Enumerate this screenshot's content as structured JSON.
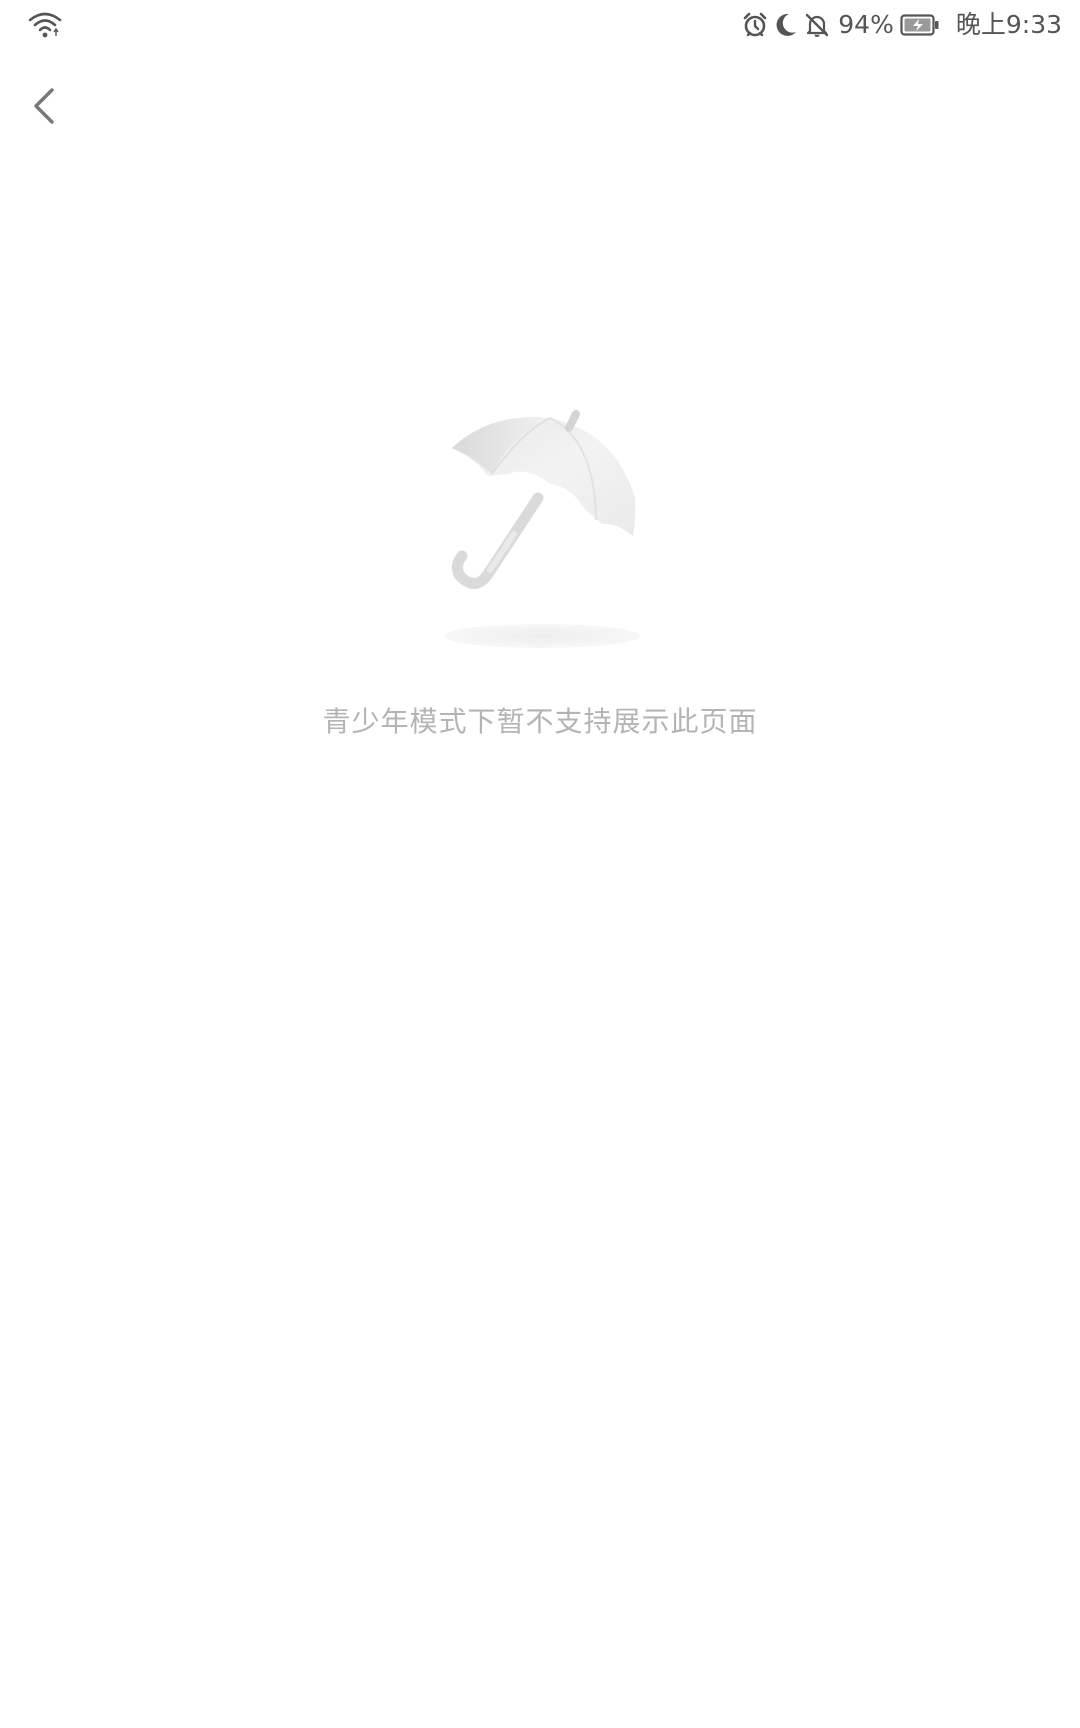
{
  "status_bar": {
    "battery_percent": "94%",
    "time": "晚上9:33",
    "icons": [
      "wifi-icon",
      "alarm-icon",
      "moon-icon",
      "bell-off-icon",
      "battery-charging-icon"
    ]
  },
  "nav": {
    "back_icon": "chevron-left-icon"
  },
  "empty_state": {
    "illustration": "umbrella-icon",
    "message": "青少年模式下暂不支持展示此页面"
  },
  "colors": {
    "background": "#ffffff",
    "status_text": "#555555",
    "message_text": "#b4b4b4",
    "back_icon": "#777777"
  }
}
